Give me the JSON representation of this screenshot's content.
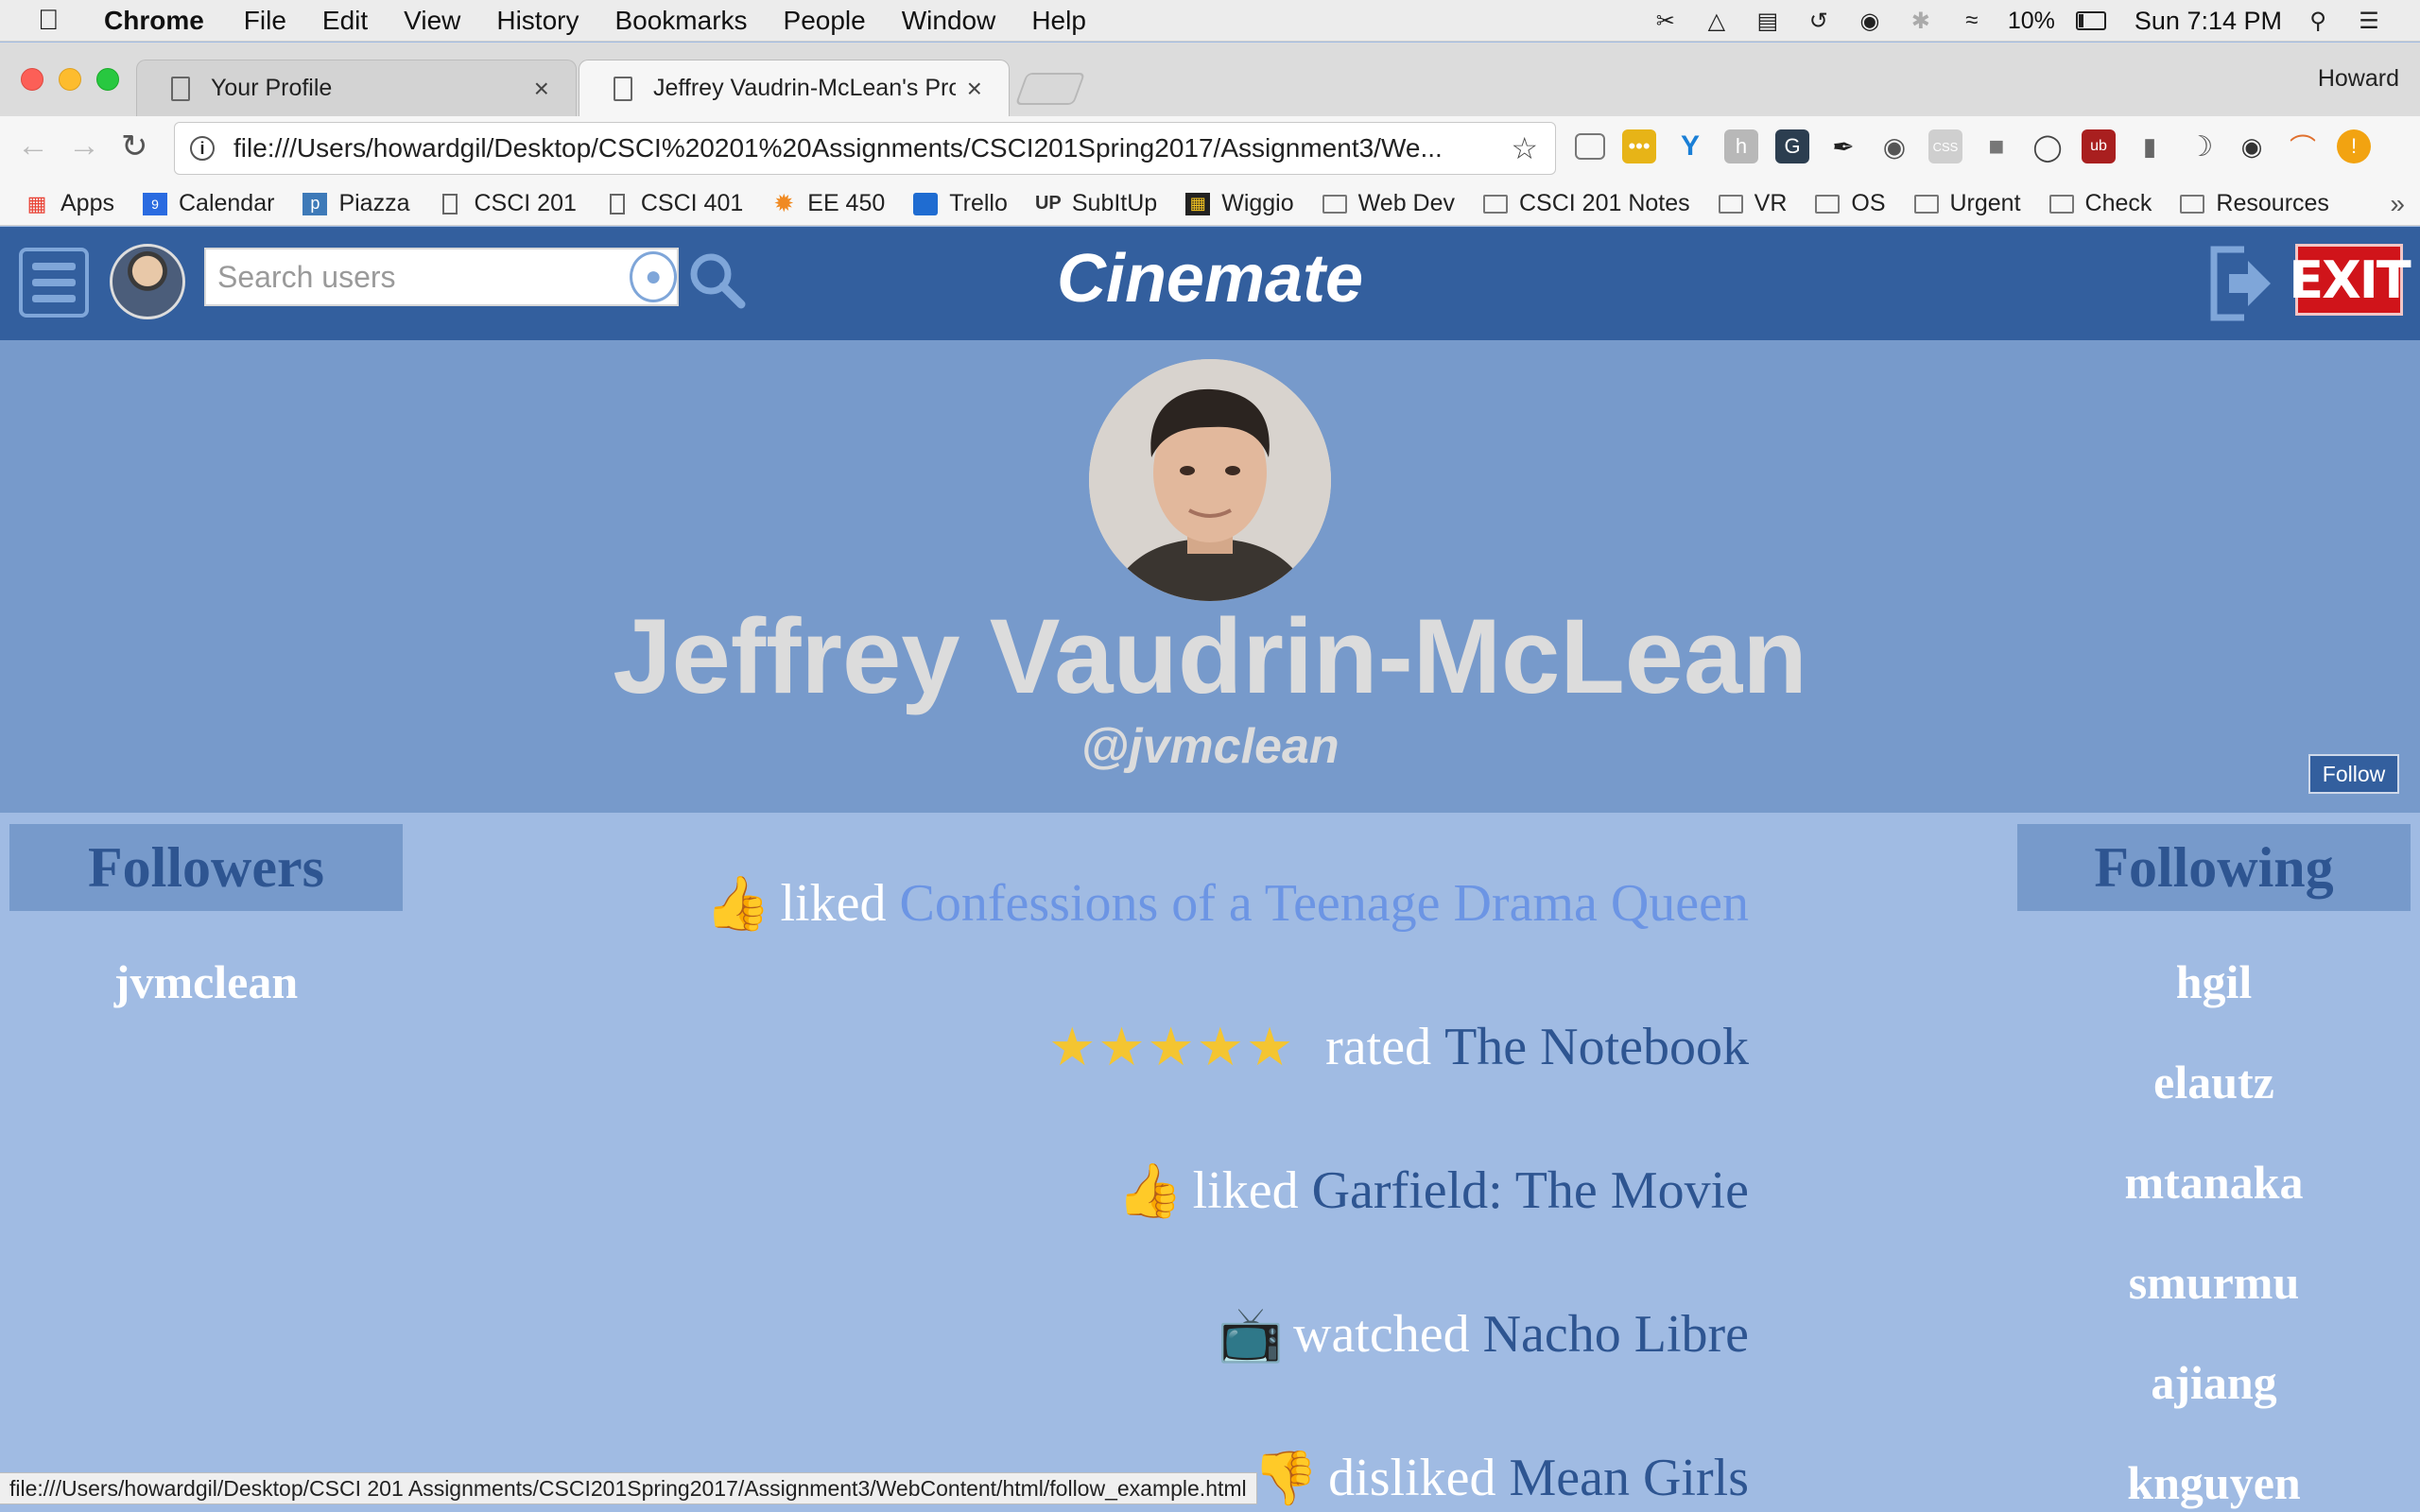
{
  "menubar": {
    "app_name": "Chrome",
    "items": [
      "File",
      "Edit",
      "View",
      "History",
      "Bookmarks",
      "People",
      "Window",
      "Help"
    ],
    "battery": "10%",
    "clock": "Sun 7:14 PM"
  },
  "tabs": [
    {
      "title": "Your Profile"
    },
    {
      "title": "Jeffrey Vaudrin-McLean's Prof"
    }
  ],
  "profile_user": "Howard",
  "omnibox": {
    "url": "file:///Users/howardgil/Desktop/CSCI%20201%20Assignments/CSCI201Spring2017/Assignment3/We..."
  },
  "bookmarks": [
    {
      "label": "Apps",
      "icon": "apps-grid-icon"
    },
    {
      "label": "Calendar",
      "icon": "calendar-icon"
    },
    {
      "label": "Piazza",
      "icon": "piazza-icon"
    },
    {
      "label": "CSCI 201",
      "icon": "page-icon"
    },
    {
      "label": "CSCI 401",
      "icon": "page-icon"
    },
    {
      "label": "EE 450",
      "icon": "ee-icon"
    },
    {
      "label": "Trello",
      "icon": "trello-icon"
    },
    {
      "label": "SubItUp",
      "icon": "subitup-icon"
    },
    {
      "label": "Wiggio",
      "icon": "wiggio-icon"
    },
    {
      "label": "Web Dev",
      "icon": "folder-icon"
    },
    {
      "label": "CSCI 201 Notes",
      "icon": "folder-icon"
    },
    {
      "label": "VR",
      "icon": "folder-icon"
    },
    {
      "label": "OS",
      "icon": "folder-icon"
    },
    {
      "label": "Urgent",
      "icon": "folder-icon"
    },
    {
      "label": "Check",
      "icon": "folder-icon"
    },
    {
      "label": "Resources",
      "icon": "folder-icon"
    }
  ],
  "header": {
    "brand": "Cinemate",
    "search_placeholder": "Search users",
    "exit_label": "EXIT"
  },
  "profile": {
    "name": "Jeffrey Vaudrin-McLean",
    "handle": "@jvmclean",
    "follow_label": "Follow"
  },
  "followers": {
    "title": "Followers",
    "users": [
      "jvmclean"
    ]
  },
  "following": {
    "title": "Following",
    "users": [
      "hgil",
      "elautz",
      "mtanaka",
      "smurmu",
      "ajiang",
      "knguyen"
    ]
  },
  "feed": [
    {
      "icon": "thumbs-up-icon",
      "verb": "liked",
      "movie": "Confessions of a Teenage Drama Queen",
      "highlight": true
    },
    {
      "icon": "five-stars-icon",
      "verb": "rated",
      "movie": "The Notebook",
      "rating": 5
    },
    {
      "icon": "thumbs-up-icon",
      "verb": "liked",
      "movie": "Garfield: The Movie"
    },
    {
      "icon": "tv-icon",
      "verb": "watched",
      "movie": "Nacho Libre"
    },
    {
      "icon": "thumbs-down-icon",
      "verb": "disliked",
      "movie": "Mean Girls"
    }
  ],
  "status_url": "file:///Users/howardgil/Desktop/CSCI 201 Assignments/CSCI201Spring2017/Assignment3/WebContent/html/follow_example.html"
}
